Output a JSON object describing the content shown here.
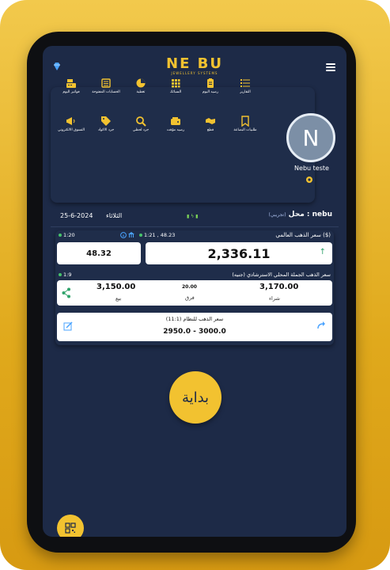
{
  "header": {
    "logo_main": "NE BU",
    "logo_sub": "JEWELLERY SYSTEMS"
  },
  "colors": {
    "accent": "#f2c230",
    "screen_bg": "#1d2a47",
    "card_bg": "#1f2d4a",
    "up_green": "#2fa36b"
  },
  "tiles": [
    {
      "label": "فواتير اليوم",
      "icon": "cash-register-icon"
    },
    {
      "label": "الحسابات المفتوحة",
      "icon": "ledger-icon"
    },
    {
      "label": "تغطية",
      "icon": "pie-chart-icon"
    },
    {
      "label": "السبائك",
      "icon": "gold-bars-icon"
    },
    {
      "label": "رصيد اليوم",
      "icon": "clipboard-icon"
    },
    {
      "label": "التقارير",
      "icon": "list-icon"
    },
    {
      "label": "التسوق الالكتروني",
      "icon": "megaphone-icon"
    },
    {
      "label": "جرد الاكواد",
      "icon": "tags-icon"
    },
    {
      "label": "جرد لحظي",
      "icon": "search-icon"
    },
    {
      "label": "رصيد مؤقت",
      "icon": "wallet-icon"
    },
    {
      "label": "قطع",
      "icon": "handshake-icon"
    },
    {
      "label": "طلبيات البضاعة",
      "icon": "bookmark-icon"
    }
  ],
  "profile": {
    "initial": "N",
    "name": "Nebu teste"
  },
  "daterow": {
    "date": "25-6-2024",
    "day": "الثلاثاء",
    "place_label": "محل : nebu",
    "place_demo": "(تجريبي)"
  },
  "world_gold": {
    "title": "سعر الذهب العالمي ($)",
    "updated": "1:21 , 48.23",
    "price": "2,336.11",
    "left_time": "1:20",
    "left_value": "48.32"
  },
  "local_gold": {
    "title": "سعر الذهب الجملة المحلي الاسترشادي (جنيه)",
    "time": "1:9",
    "sell_price": "3,150.00",
    "sell_label": "بيع",
    "diff_value": "20.00",
    "diff_label": "فرق",
    "buy_price": "3,170.00",
    "buy_label": "شراء"
  },
  "system_gold": {
    "label_prefix": "(11:1)",
    "title": "سعر الذهب للنظام",
    "range": "2950.0 - 3000.0"
  },
  "start_button": "بداية"
}
